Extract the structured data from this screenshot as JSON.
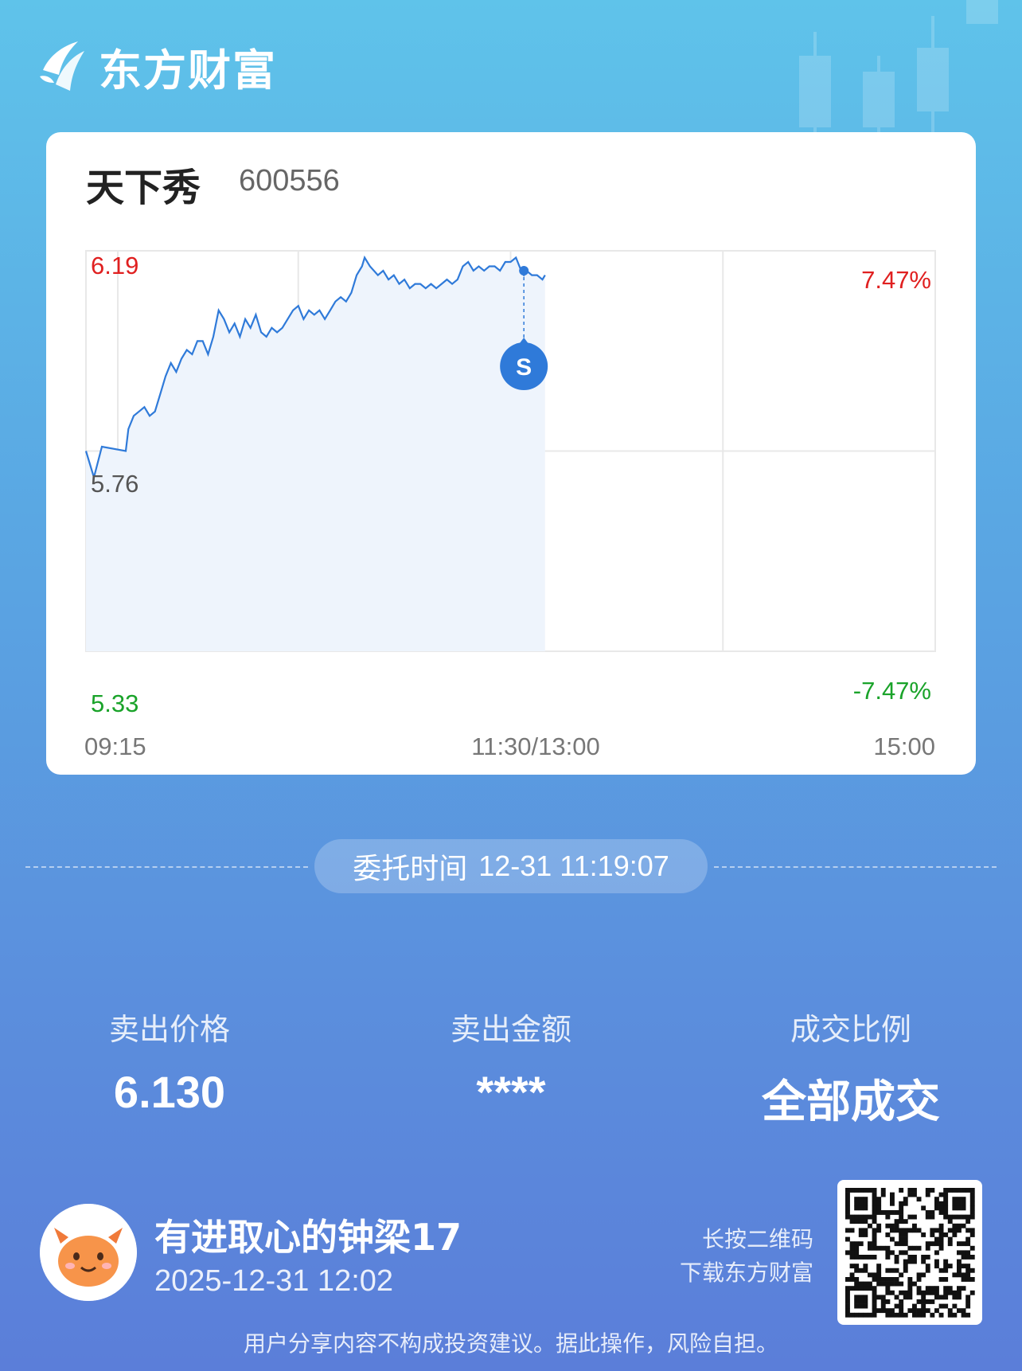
{
  "brand": {
    "name": "东方财富"
  },
  "stock": {
    "name": "天下秀",
    "code": "600556"
  },
  "chart_data": {
    "type": "line",
    "series": [
      {
        "values": [
          [
            0,
            5.76
          ],
          [
            3,
            5.7
          ],
          [
            6,
            5.77
          ],
          [
            15,
            5.76
          ],
          [
            16,
            5.81
          ],
          [
            18,
            5.84
          ],
          [
            20,
            5.85
          ],
          [
            22,
            5.86
          ],
          [
            24,
            5.84
          ],
          [
            26,
            5.85
          ],
          [
            28,
            5.89
          ],
          [
            30,
            5.93
          ],
          [
            32,
            5.96
          ],
          [
            34,
            5.94
          ],
          [
            36,
            5.97
          ],
          [
            38,
            5.99
          ],
          [
            40,
            5.98
          ],
          [
            42,
            6.01
          ],
          [
            44,
            6.01
          ],
          [
            46,
            5.98
          ],
          [
            48,
            6.02
          ],
          [
            50,
            6.08
          ],
          [
            52,
            6.06
          ],
          [
            54,
            6.03
          ],
          [
            56,
            6.05
          ],
          [
            58,
            6.02
          ],
          [
            60,
            6.06
          ],
          [
            62,
            6.04
          ],
          [
            64,
            6.07
          ],
          [
            66,
            6.03
          ],
          [
            68,
            6.02
          ],
          [
            70,
            6.04
          ],
          [
            72,
            6.03
          ],
          [
            74,
            6.04
          ],
          [
            76,
            6.06
          ],
          [
            78,
            6.08
          ],
          [
            80,
            6.09
          ],
          [
            82,
            6.06
          ],
          [
            84,
            6.08
          ],
          [
            86,
            6.07
          ],
          [
            88,
            6.08
          ],
          [
            90,
            6.06
          ],
          [
            92,
            6.08
          ],
          [
            94,
            6.1
          ],
          [
            96,
            6.11
          ],
          [
            98,
            6.1
          ],
          [
            100,
            6.12
          ],
          [
            102,
            6.16
          ],
          [
            104,
            6.18
          ],
          [
            105,
            6.2
          ],
          [
            107,
            6.18
          ],
          [
            110,
            6.16
          ],
          [
            112,
            6.17
          ],
          [
            114,
            6.15
          ],
          [
            116,
            6.16
          ],
          [
            118,
            6.14
          ],
          [
            120,
            6.15
          ],
          [
            122,
            6.13
          ],
          [
            124,
            6.14
          ],
          [
            126,
            6.14
          ],
          [
            128,
            6.13
          ],
          [
            130,
            6.14
          ],
          [
            132,
            6.13
          ],
          [
            134,
            6.14
          ],
          [
            136,
            6.15
          ],
          [
            138,
            6.14
          ],
          [
            140,
            6.15
          ],
          [
            142,
            6.18
          ],
          [
            144,
            6.19
          ],
          [
            146,
            6.17
          ],
          [
            148,
            6.18
          ],
          [
            150,
            6.17
          ],
          [
            152,
            6.18
          ],
          [
            154,
            6.18
          ],
          [
            156,
            6.17
          ],
          [
            158,
            6.19
          ],
          [
            160,
            6.19
          ],
          [
            162,
            6.2
          ],
          [
            164,
            6.17
          ],
          [
            165,
            6.16
          ],
          [
            166,
            6.17
          ],
          [
            168,
            6.16
          ],
          [
            170,
            6.16
          ],
          [
            172,
            6.15
          ],
          [
            173,
            6.16
          ]
        ]
      }
    ],
    "price_ticks": {
      "high": "6.19",
      "mid": "5.76",
      "low": "5.33"
    },
    "pct_ticks": {
      "high": "7.47%",
      "low": "-7.47%"
    },
    "time_ticks": [
      "09:15",
      "11:30/13:00",
      "15:00"
    ],
    "ylim": [
      5.33,
      6.19
    ],
    "marker": {
      "label": "S",
      "x": 165,
      "y": 6.17
    },
    "colors": {
      "line": "#2f7ad9",
      "fill": "#eef4fc",
      "up": "#e02020",
      "down": "#1aa32a",
      "grid": "#e8e8e8",
      "marker": "#2f7ad9"
    }
  },
  "order": {
    "time_label": "委托时间",
    "time_value": "12-31 11:19:07"
  },
  "stats": {
    "price_label": "卖出价格",
    "price_value": "6.130",
    "amount_label": "卖出金额",
    "amount_value": "****",
    "ratio_label": "成交比例",
    "ratio_value": "全部成交"
  },
  "user": {
    "name": "有进取心的钟梁17",
    "date": "2025-12-31 12:02"
  },
  "qr_tip": {
    "line1": "长按二维码",
    "line2": "下载东方财富"
  },
  "disclaimer": "用户分享内容不构成投资建议。据此操作，风险自担。"
}
